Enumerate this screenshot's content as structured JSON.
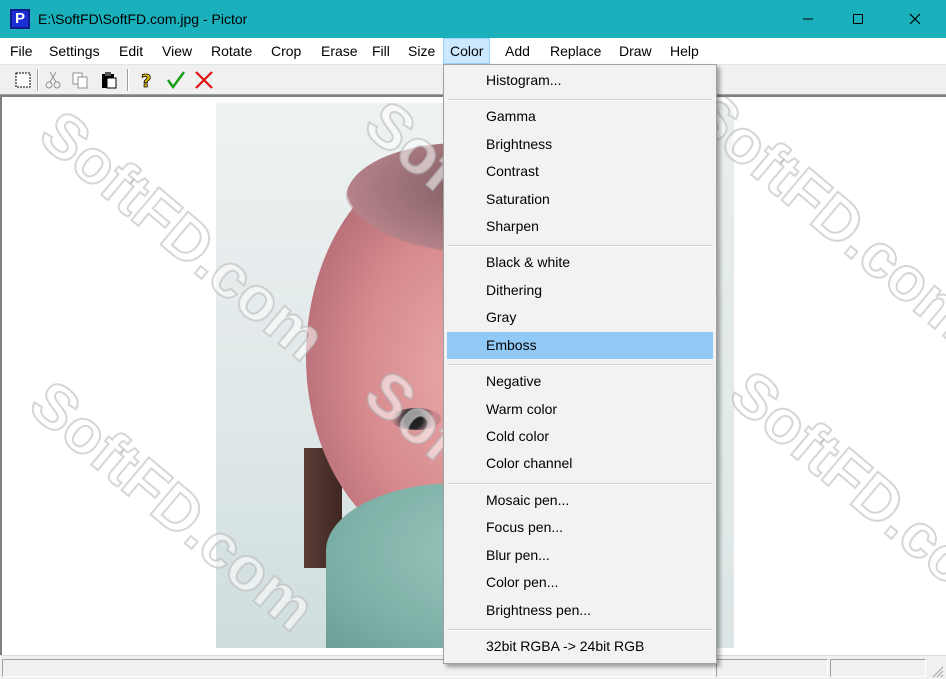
{
  "window": {
    "title": "E:\\SoftFD\\SoftFD.com.jpg - Pictor",
    "app_icon_letter": "P"
  },
  "menubar": {
    "items": [
      "File",
      "Settings",
      "Edit",
      "View",
      "Rotate",
      "Crop",
      "Erase",
      "Fill",
      "Size",
      "Color",
      "Add",
      "Replace",
      "Draw",
      "Help"
    ],
    "active": "Color"
  },
  "toolbar": {
    "buttons": [
      "select-icon",
      "cut-icon",
      "copy-icon",
      "paste-icon",
      "help-icon",
      "checkmark-icon",
      "cancel-x-icon"
    ],
    "accent_check": "#1a9e1a",
    "accent_x": "#e01010"
  },
  "color_menu": {
    "items": [
      "Histogram...",
      "Gamma",
      "Brightness",
      "Contrast",
      "Saturation",
      "Sharpen",
      "Black & white",
      "Dithering",
      "Gray",
      "Emboss",
      "Negative",
      "Warm color",
      "Cold color",
      "Color channel",
      "Mosaic pen...",
      "Focus pen...",
      "Blur pen...",
      "Color pen...",
      "Brightness pen...",
      "32bit RGBA -> 24bit RGB"
    ],
    "highlighted": "Emboss",
    "highlight_color": "#91c9f7"
  },
  "watermark": {
    "text": "SoftFD.com"
  },
  "colors": {
    "titlebar": "#1ab0bc"
  }
}
